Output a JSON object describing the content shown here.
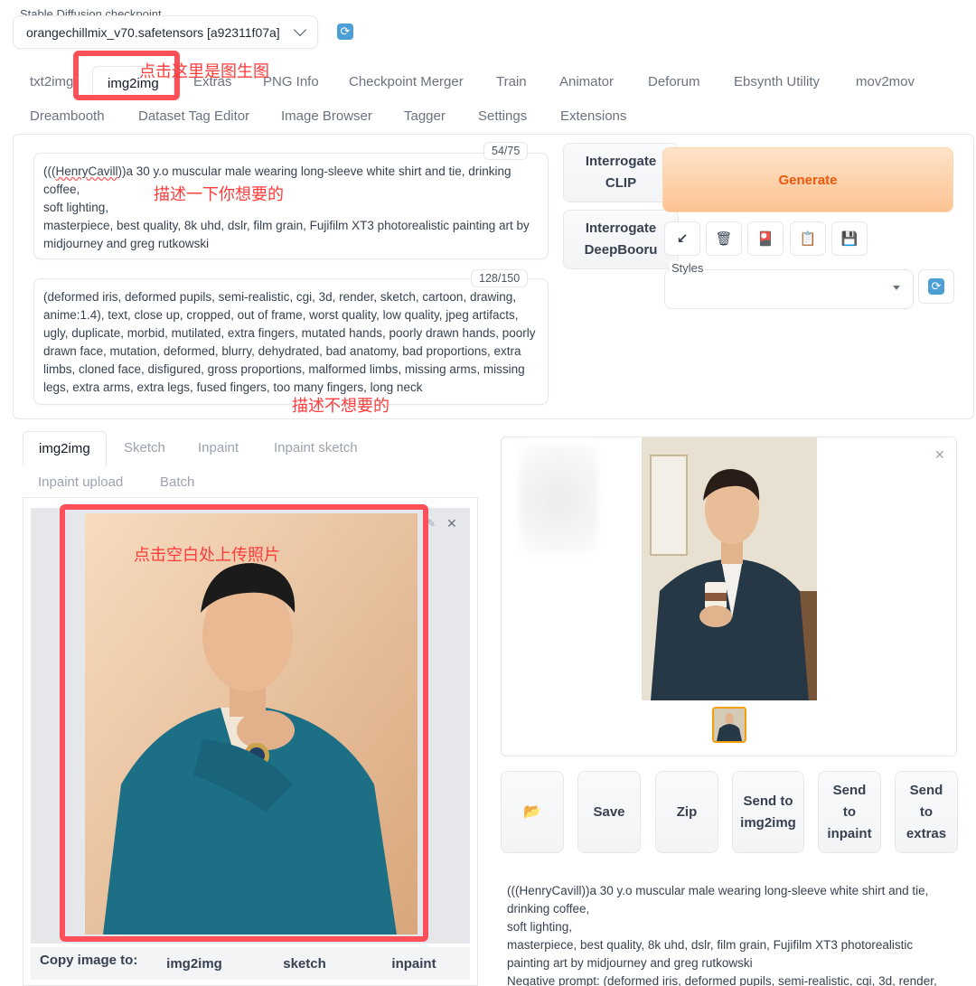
{
  "checkpoint": {
    "label": "Stable Diffusion checkpoint",
    "value": "orangechillmix_v70.safetensors [a92311f07a]"
  },
  "main_tabs": [
    "txt2img",
    "img2img",
    "Extras",
    "PNG Info",
    "Checkpoint Merger",
    "Train",
    "Animator",
    "Deforum",
    "Ebsynth Utility",
    "mov2mov",
    "Dreambooth",
    "Dataset Tag Editor",
    "Image Browser",
    "Tagger",
    "Settings",
    "Extensions"
  ],
  "prompt": {
    "counter": "54/75",
    "name_part": "HenryCavill",
    "line1_prefix": "(((",
    "line1_suffix": "))a 30 y.o muscular male wearing long-sleeve white shirt and tie, drinking",
    "line2": "coffee,",
    "line3": "soft lighting,",
    "line4": "masterpiece, best quality, 8k uhd, dslr, film grain, Fujifilm XT3 photorealistic painting art by",
    "line5": "midjourney and greg rutkowski"
  },
  "negative_prompt": {
    "counter": "128/150",
    "lines": [
      "(deformed iris, deformed pupils, semi-realistic, cgi, 3d, render, sketch, cartoon, drawing,",
      "anime:1.4), text, close up, cropped, out of frame, worst quality, low quality, jpeg artifacts,",
      "ugly, duplicate, morbid, mutilated, extra fingers, mutated hands, poorly drawn hands, poorly",
      "drawn face, mutation, deformed, blurry, dehydrated, bad anatomy, bad proportions, extra",
      "limbs, cloned face, disfigured, gross proportions, malformed limbs, missing arms, missing",
      "legs, extra arms, extra legs, fused fingers, too many fingers, long neck"
    ]
  },
  "buttons": {
    "interrogate_clip_1": "Interrogate",
    "interrogate_clip_2": "CLIP",
    "interrogate_deepbooru_1": "Interrogate",
    "interrogate_deepbooru_2": "DeepBooru",
    "generate": "Generate"
  },
  "tool_icons": [
    "↙",
    "🗑",
    "🎴",
    "📋",
    "💾"
  ],
  "styles_label": "Styles",
  "sub_tabs": [
    "img2img",
    "Sketch",
    "Inpaint",
    "Inpaint sketch",
    "Inpaint upload",
    "Batch"
  ],
  "copy_image": {
    "label": "Copy image to:",
    "targets": [
      "img2img",
      "sketch",
      "inpaint"
    ]
  },
  "result_actions": [
    {
      "icon": "📂"
    },
    {
      "label": "Save"
    },
    {
      "label": "Zip"
    },
    {
      "line1": "Send to",
      "line2": "img2img"
    },
    {
      "line1": "Send",
      "line2": "to",
      "line3": "inpaint"
    },
    {
      "line1": "Send",
      "line2": "to",
      "line3": "extras"
    }
  ],
  "result_info": {
    "line1": "(((HenryCavill))a 30 y.o muscular male wearing long-sleeve white shirt and tie,",
    "line2": "drinking coffee,",
    "line3": "soft lighting,",
    "line4": "masterpiece, best quality, 8k uhd, dslr, film grain, Fujifilm XT3 photorealistic",
    "line5": "painting art by midjourney and greg rutkowski",
    "line6": "Negative prompt: (deformed iris, deformed pupils, semi-realistic, cgi, 3d, render,"
  },
  "annotations": {
    "img2img_tab": "点击这里是图生图",
    "prompt": "描述一下你想要的",
    "negative": "描述不想要的",
    "upload": "点击空白处上传照片"
  },
  "colors": {
    "annotation_red": "#ff4f58",
    "generate_orange": "#ea580c",
    "thumb_border": "#f59e0b"
  }
}
